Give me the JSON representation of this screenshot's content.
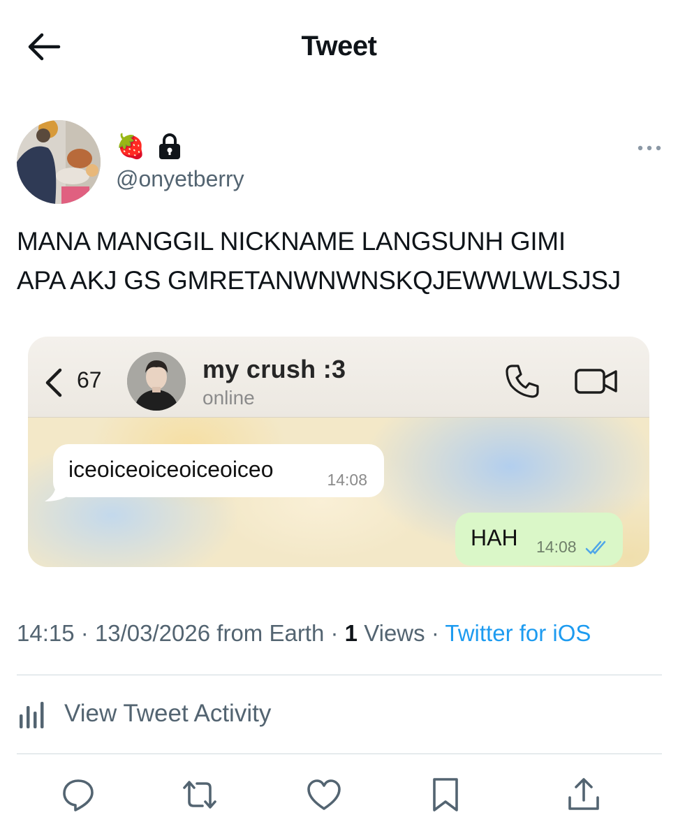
{
  "header": {
    "title": "Tweet",
    "back_icon": "arrow-left-icon"
  },
  "author": {
    "avatar_icon": "avatar-photo",
    "display_name_emoji": "🍓",
    "locked_icon": "lock-icon",
    "handle": "@onyetberry",
    "more_icon": "more-dots-icon"
  },
  "tweet": {
    "text_line1": "MANA MANGGIL NICKNAME LANGSUNH GIMI",
    "text_line2": "APA AKJ GS GMRETANWNWNSKQJEWWLWLSJSJ"
  },
  "media": {
    "chat": {
      "back_icon": "chevron-left-icon",
      "unread_count": "67",
      "contact_name": "my crush :3",
      "contact_status": "online",
      "call_icon": "phone-icon",
      "video_icon": "video-camera-icon",
      "messages": [
        {
          "direction": "incoming",
          "text": "iceoiceoiceoiceoiceo",
          "time": "14:08"
        },
        {
          "direction": "outgoing",
          "text": "HAH",
          "time": "14:08",
          "status_icon": "double-check-icon"
        }
      ]
    }
  },
  "meta": {
    "time": "14:15",
    "date": "13/03/2026",
    "location": "from Earth",
    "views_count": "1",
    "views_label": "Views",
    "source": "Twitter for iOS"
  },
  "activity": {
    "label": "View Tweet Activity",
    "icon": "bar-chart-icon"
  },
  "actions": [
    "reply-icon",
    "retweet-icon",
    "like-icon",
    "bookmark-icon",
    "share-icon"
  ],
  "colors": {
    "link": "#1d9bf0",
    "secondary_text": "#536471",
    "outgoing_bubble": "#daf7c8",
    "read_check": "#4fa6e8"
  }
}
